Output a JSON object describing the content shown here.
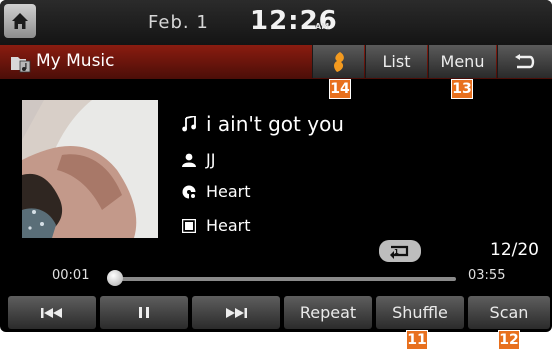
{
  "status": {
    "date": "Feb. 1",
    "time": "12:26",
    "ampm": "AM"
  },
  "titlebar": {
    "title": "My Music",
    "list_label": "List",
    "menu_label": "Menu"
  },
  "track": {
    "title": "i ain't got you",
    "artist": "JJ",
    "album": "Heart",
    "genre": "Heart",
    "position": "12/20",
    "elapsed": "00:01",
    "total": "03:55",
    "progress": 0.01
  },
  "controls": {
    "repeat_label": "Repeat",
    "shuffle_label": "Shuffle",
    "scan_label": "Scan"
  },
  "callouts": [
    "14",
    "13",
    "11",
    "12"
  ],
  "colors": {
    "title_bar": "#6b140b",
    "callout": "#e8701e",
    "orange_icon": "#f39a1f"
  },
  "icons": [
    "home-icon",
    "music-folder-icon",
    "orange-app-icon",
    "back-icon",
    "note-icon",
    "person-icon",
    "disc-icon",
    "album-icon",
    "repeat-icon",
    "previous-icon",
    "pause-icon",
    "next-icon"
  ]
}
